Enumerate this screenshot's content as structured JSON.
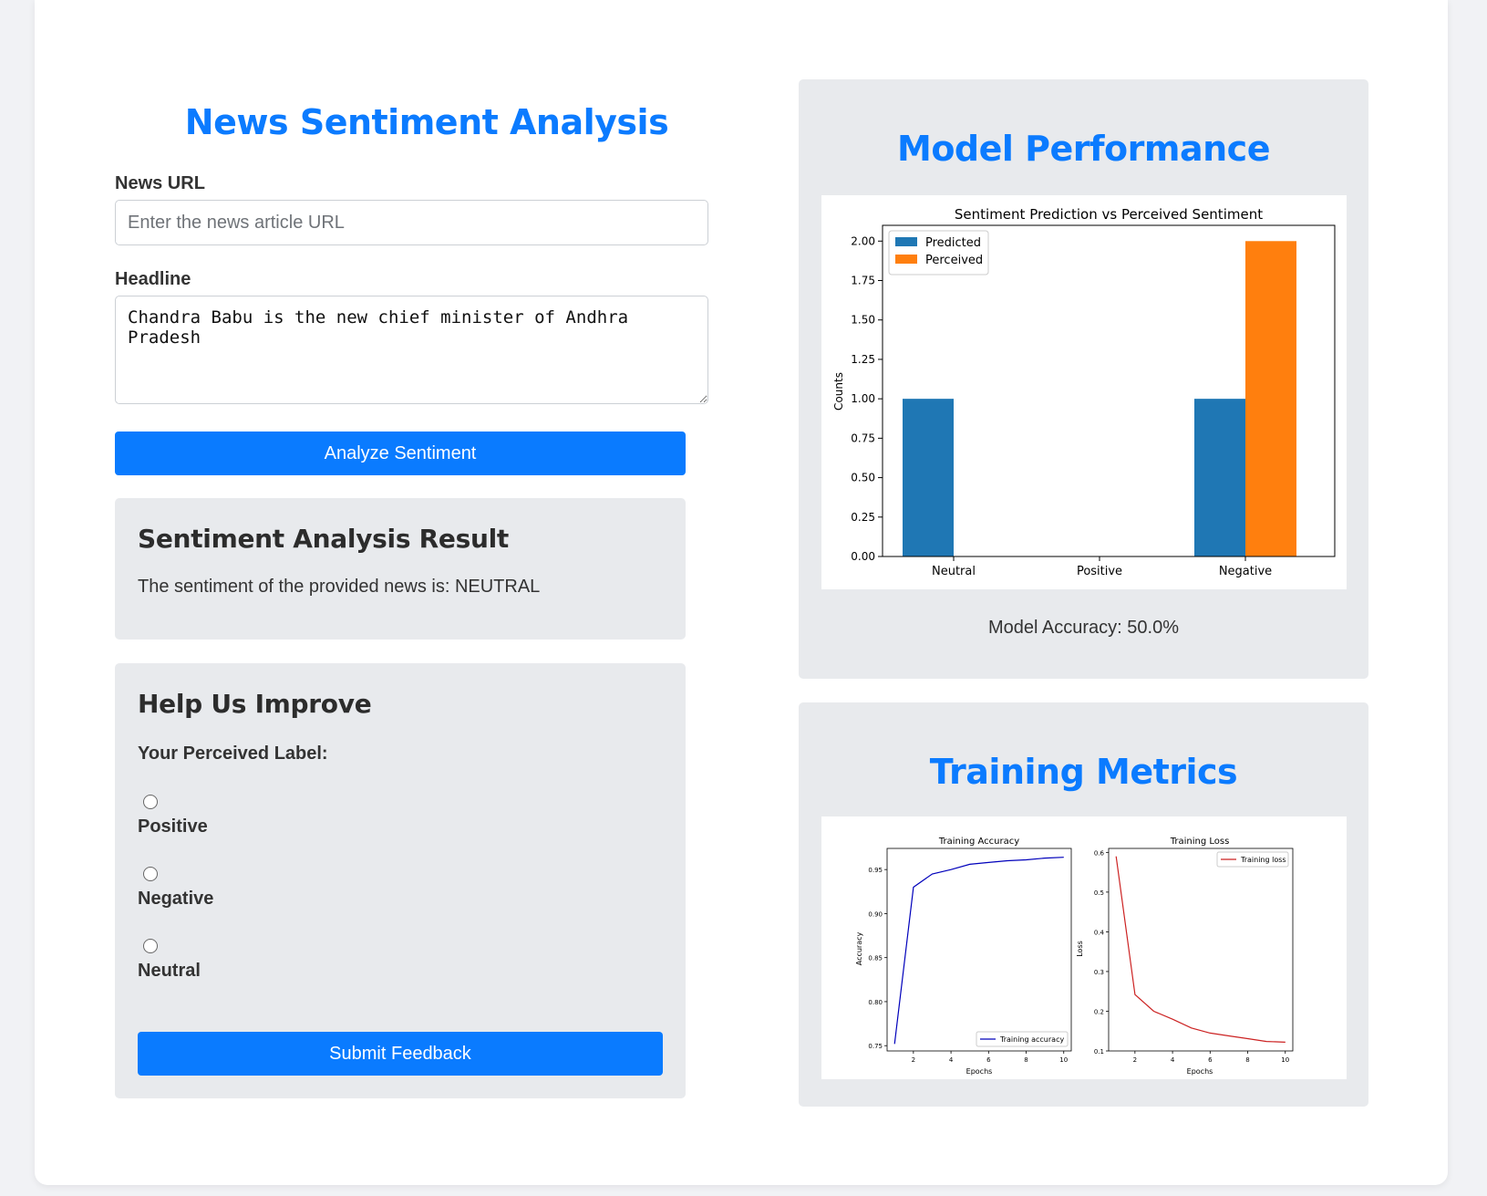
{
  "left": {
    "title": "News Sentiment Analysis",
    "url_label": "News URL",
    "url_placeholder": "Enter the news article URL",
    "url_value": "",
    "headline_label": "Headline",
    "headline_value": "Chandra Babu is the new chief minister of Andhra Pradesh",
    "analyze_button": "Analyze Sentiment",
    "result": {
      "heading": "Sentiment Analysis Result",
      "text": "The sentiment of the provided news is: NEUTRAL"
    },
    "feedback": {
      "heading": "Help Us Improve",
      "label": "Your Perceived Label:",
      "options": [
        "Positive",
        "Negative",
        "Neutral"
      ],
      "submit_button": "Submit Feedback"
    }
  },
  "right": {
    "performance_title": "Model Performance",
    "accuracy_text": "Model Accuracy: 50.0%",
    "training_title": "Training Metrics"
  },
  "colors": {
    "accent": "#0a7bff",
    "predicted": "#1f77b4",
    "perceived": "#ff7f0e",
    "accuracy_line": "#0000bb",
    "loss_line": "#cc2222"
  },
  "chart_data": [
    {
      "type": "bar",
      "title": "Sentiment Prediction vs Perceived Sentiment",
      "xlabel": "",
      "ylabel": "Counts",
      "categories": [
        "Neutral",
        "Positive",
        "Negative"
      ],
      "series": [
        {
          "name": "Predicted",
          "values": [
            1,
            0,
            1
          ]
        },
        {
          "name": "Perceived",
          "values": [
            0,
            0,
            2
          ]
        }
      ],
      "ylim": [
        0,
        2.1
      ],
      "yticks": [
        "0.00",
        "0.25",
        "0.50",
        "0.75",
        "1.00",
        "1.25",
        "1.50",
        "1.75",
        "2.00"
      ],
      "legend": "top-left"
    },
    {
      "type": "line",
      "title": "Training Accuracy",
      "xlabel": "Epochs",
      "ylabel": "Accuracy",
      "x": [
        1,
        2,
        3,
        4,
        5,
        6,
        7,
        8,
        9,
        10
      ],
      "series": [
        {
          "name": "Training accuracy",
          "values": [
            0.752,
            0.93,
            0.945,
            0.95,
            0.956,
            0.958,
            0.96,
            0.961,
            0.963,
            0.964
          ]
        }
      ],
      "xticks": [
        "2",
        "4",
        "6",
        "8",
        "10"
      ],
      "yticks": [
        "0.75",
        "0.80",
        "0.85",
        "0.90",
        "0.95"
      ],
      "xlim": [
        0.6,
        10.4
      ],
      "ylim": [
        0.744,
        0.974
      ],
      "legend": "bottom-right"
    },
    {
      "type": "line",
      "title": "Training Loss",
      "xlabel": "Epochs",
      "ylabel": "Loss",
      "x": [
        1,
        2,
        3,
        4,
        5,
        6,
        7,
        8,
        9,
        10
      ],
      "series": [
        {
          "name": "Training loss",
          "values": [
            0.59,
            0.242,
            0.2,
            0.18,
            0.158,
            0.145,
            0.138,
            0.131,
            0.124,
            0.122
          ]
        }
      ],
      "xticks": [
        "2",
        "4",
        "6",
        "8",
        "10"
      ],
      "yticks": [
        "0.1",
        "0.2",
        "0.3",
        "0.4",
        "0.5",
        "0.6"
      ],
      "xlim": [
        0.6,
        10.4
      ],
      "ylim": [
        0.1,
        0.61
      ],
      "legend": "top-right"
    }
  ]
}
